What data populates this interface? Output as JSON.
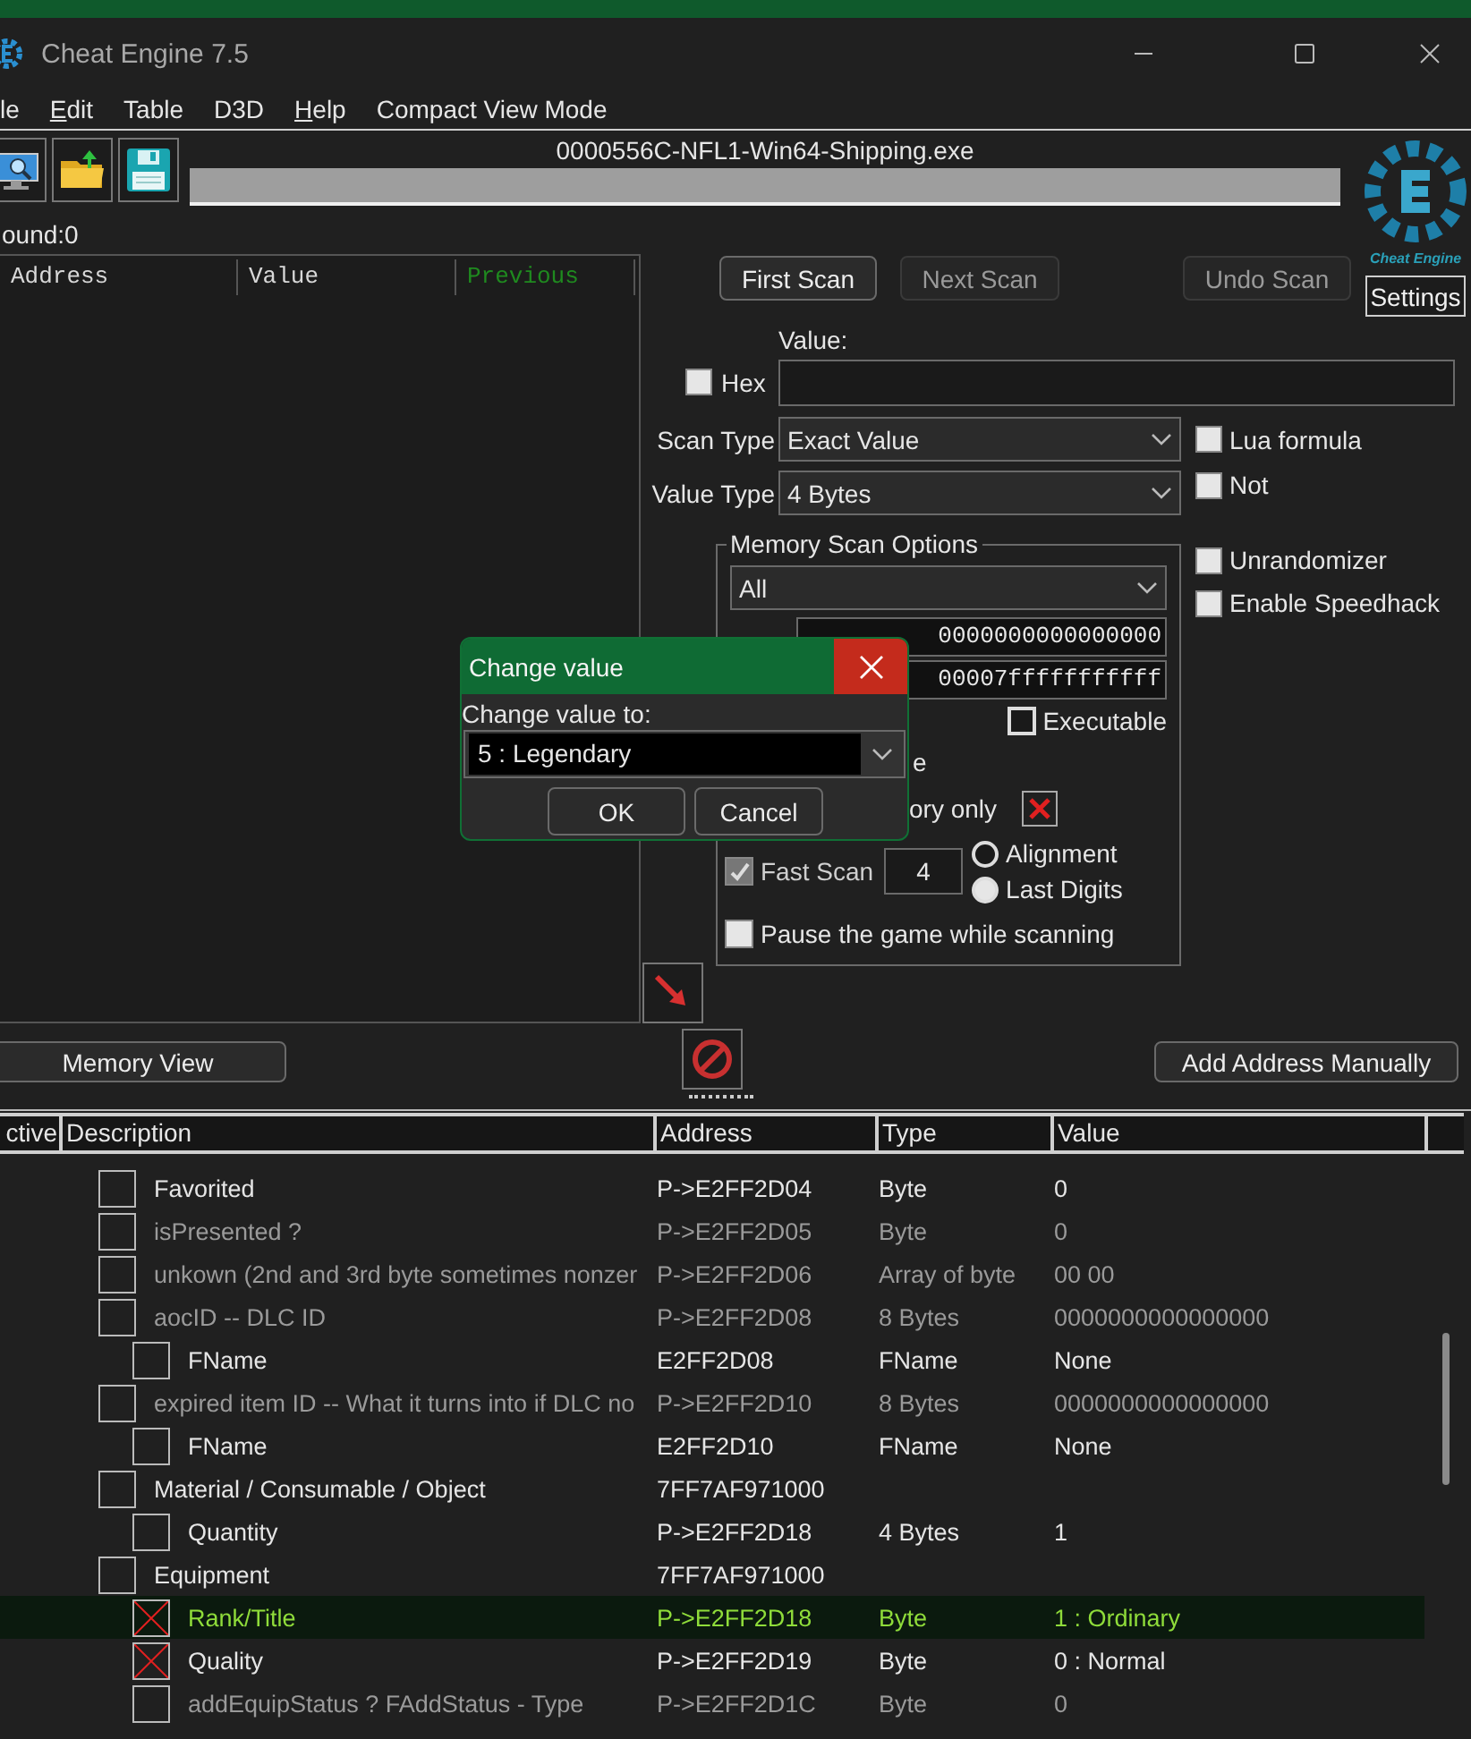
{
  "window": {
    "title": "Cheat Engine 7.5"
  },
  "menu": [
    {
      "label": "le",
      "underlined": false
    },
    {
      "label": "Edit",
      "underlined": true
    },
    {
      "label": "Table",
      "underlined": false
    },
    {
      "label": "D3D",
      "underlined": false
    },
    {
      "label": "Help",
      "underlined": true
    },
    {
      "label": "Compact View Mode",
      "underlined": false
    }
  ],
  "process": "0000556C-NFL1-Win64-Shipping.exe",
  "progress": {
    "level": 0
  },
  "found_label": "ound:0",
  "results_columns": [
    {
      "label": "Address",
      "color": "#d8d8d8"
    },
    {
      "label": "Value",
      "color": "#d8d8d8"
    },
    {
      "label": "Previous",
      "color": "#1f8a1f"
    }
  ],
  "scan_buttons": [
    {
      "label": "First Scan",
      "disabled": false
    },
    {
      "label": "Next Scan",
      "disabled": true
    },
    {
      "label": "Undo Scan",
      "disabled": true
    }
  ],
  "logo_text": "Cheat Engine",
  "settings_button": "Settings",
  "value_label": "Value:",
  "hex": {
    "label": "Hex",
    "checked": false
  },
  "scan_type": {
    "label": "Scan Type",
    "value": "Exact Value"
  },
  "value_type": {
    "label": "Value Type",
    "value": "4 Bytes"
  },
  "side_options": [
    {
      "label": "Lua formula",
      "checked": false
    },
    {
      "label": "Not",
      "checked": false
    },
    {
      "label": "Unrandomizer",
      "checked": false
    },
    {
      "label": "Enable Speedhack",
      "checked": false
    }
  ],
  "memory_scan_options": {
    "title": "Memory Scan Options",
    "region": "All",
    "start": "0000000000000000",
    "stop": "00007fffffffffff",
    "executable": {
      "label": "Executable",
      "checked": false
    },
    "partial_option": {
      "label": "e"
    },
    "partial_option_2": {
      "label": "ory only",
      "checked": true
    },
    "fast_scan": {
      "label": "Fast Scan",
      "checked": true,
      "value": "4"
    },
    "alignment": [
      {
        "label": "Alignment",
        "selected": false
      },
      {
        "label": "Last Digits",
        "selected": true
      }
    ],
    "pause": {
      "label": "Pause the game while scanning",
      "checked": false
    }
  },
  "memory_view_button": "Memory View",
  "add_address_button": "Add Address Manually",
  "table": {
    "columns": [
      "ctive",
      "Description",
      "Address",
      "Type",
      "Value"
    ],
    "rows": [
      {
        "description": "Favorited",
        "address": "P->E2FF2D04",
        "type": "Byte",
        "value": "0",
        "active": false,
        "dimmed": false,
        "selected": false
      },
      {
        "description": "isPresented ?",
        "address": "P->E2FF2D05",
        "type": "Byte",
        "value": "0",
        "active": false,
        "dimmed": true,
        "selected": false
      },
      {
        "description": "unkown (2nd and 3rd byte sometimes nonzer",
        "address": "P->E2FF2D06",
        "type": "Array of byte",
        "value": "00 00",
        "active": false,
        "dimmed": true,
        "selected": false
      },
      {
        "description": "aocID -- DLC ID",
        "address": "P->E2FF2D08",
        "type": "8 Bytes",
        "value": "0000000000000000",
        "active": false,
        "dimmed": true,
        "selected": false,
        "children": [
          {
            "description": "FName",
            "address": "E2FF2D08",
            "type": "FName",
            "value": "None",
            "active": false,
            "dimmed": false,
            "selected": false
          }
        ]
      },
      {
        "description": "expired item ID -- What it turns into if DLC no",
        "address": "P->E2FF2D10",
        "type": "8 Bytes",
        "value": "0000000000000000",
        "active": false,
        "dimmed": true,
        "selected": false,
        "children": [
          {
            "description": "FName",
            "address": "E2FF2D10",
            "type": "FName",
            "value": "None",
            "active": false,
            "dimmed": false,
            "selected": false
          }
        ]
      },
      {
        "description": "Material / Consumable / Object",
        "address": "7FF7AF971000",
        "active": false,
        "dimmed": false,
        "selected": false,
        "children": [
          {
            "description": "Quantity",
            "address": "P->E2FF2D18",
            "type": "4 Bytes",
            "value": "1",
            "active": false,
            "dimmed": false,
            "selected": false
          }
        ]
      },
      {
        "description": "Equipment",
        "address": "7FF7AF971000",
        "active": false,
        "dimmed": false,
        "selected": false,
        "children": [
          {
            "description": "Rank/Title",
            "address": "P->E2FF2D18",
            "type": "Byte",
            "value": "1 : Ordinary",
            "active": true,
            "dimmed": false,
            "selected": true
          },
          {
            "description": "Quality",
            "address": "P->E2FF2D19",
            "type": "Byte",
            "value": "0 : Normal",
            "active": true,
            "dimmed": false,
            "selected": false
          },
          {
            "description": "addEquipStatus ? FAddStatus - Type",
            "address": "P->E2FF2D1C",
            "type": "Byte",
            "value": "0",
            "active": false,
            "dimmed": true,
            "selected": false
          }
        ]
      }
    ]
  },
  "dialog": {
    "title": "Change value",
    "prompt": "Change value to:",
    "value": "5 : Legendary",
    "buttons": [
      "OK",
      "Cancel"
    ]
  }
}
